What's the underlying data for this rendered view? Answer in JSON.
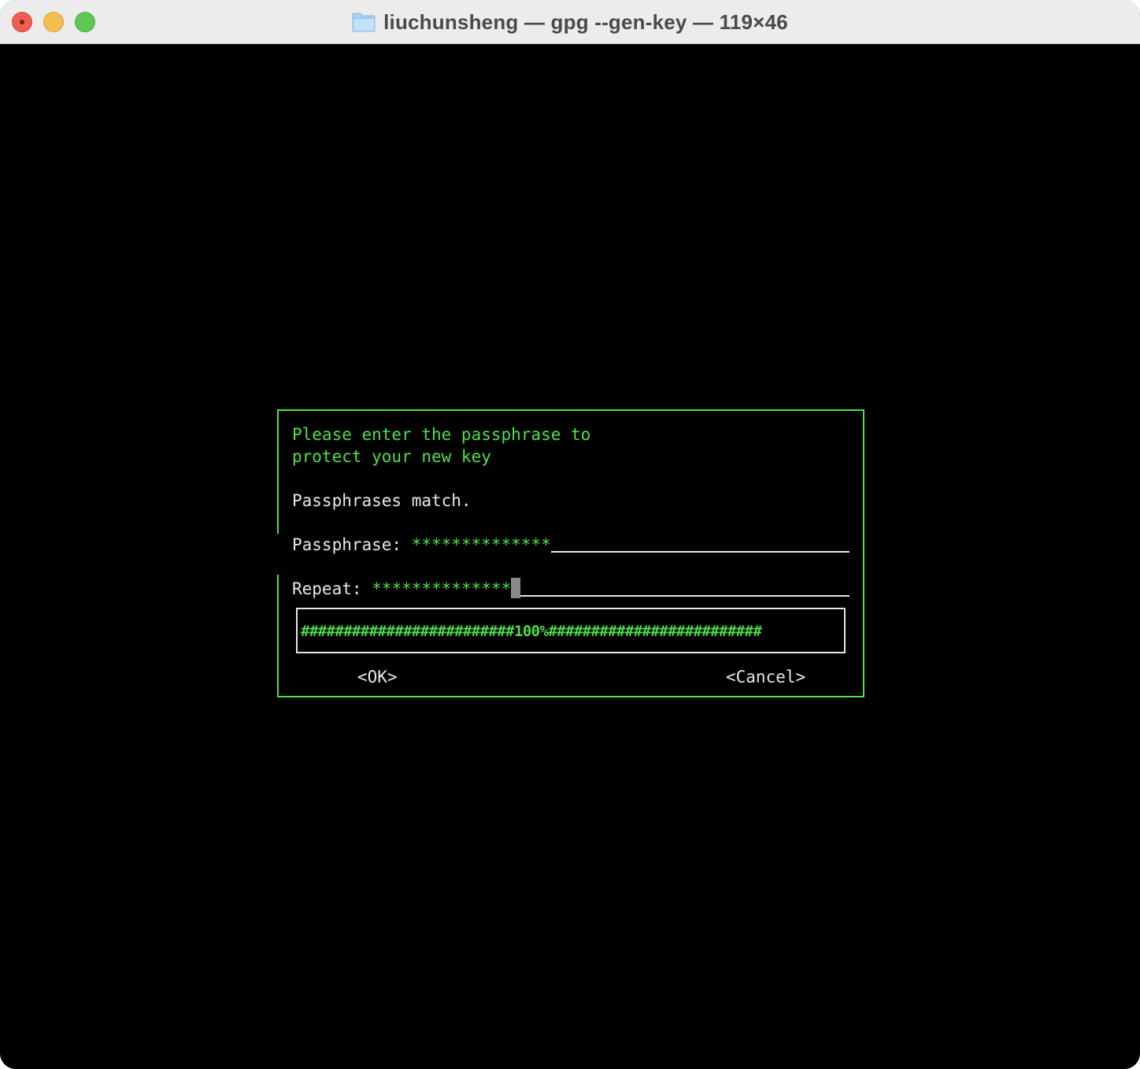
{
  "window": {
    "title": "liuchunsheng — gpg --gen-key — 119×46",
    "title_icon": "folder-icon",
    "controls": [
      "close",
      "minimize",
      "zoom"
    ]
  },
  "dialog": {
    "prompt_line1": "Please enter the passphrase to",
    "prompt_line2": "protect your new key",
    "status": "Passphrases match.",
    "passphrase_label": "Passphrase: ",
    "passphrase_value": "**************",
    "repeat_label": "Repeat: ",
    "repeat_value": "**************",
    "quality": {
      "percent": 100,
      "text": "#########################100%#########################"
    },
    "ok_label": "<OK>",
    "cancel_label": "<Cancel>"
  },
  "colors": {
    "terminal_bg": "#000000",
    "accent_green": "#4fe048",
    "text_white": "#e8e8e8",
    "cursor": "#8a8a8a"
  }
}
